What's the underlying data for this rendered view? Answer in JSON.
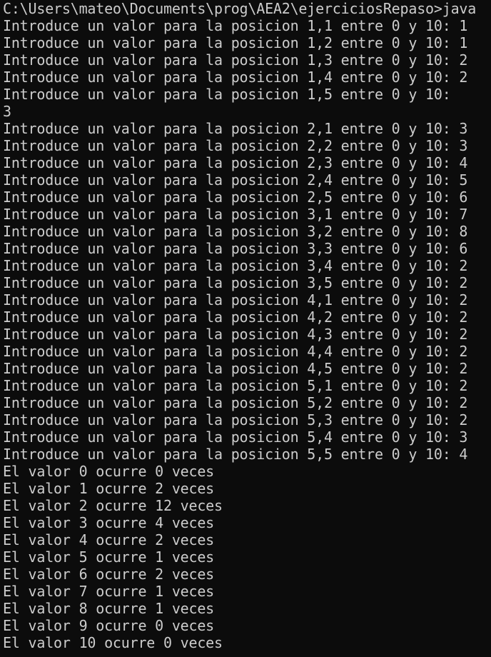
{
  "terminal": {
    "prompt": "C:\\Users\\mateo\\Documents\\prog\\AEA2\\ejerciciosRepaso>java",
    "lines": [
      "Introduce un valor para la posicion 1,1 entre 0 y 10: 1",
      "Introduce un valor para la posicion 1,2 entre 0 y 10: 1",
      "Introduce un valor para la posicion 1,3 entre 0 y 10: 2",
      "Introduce un valor para la posicion 1,4 entre 0 y 10: 2",
      "Introduce un valor para la posicion 1,5 entre 0 y 10:",
      "3",
      "Introduce un valor para la posicion 2,1 entre 0 y 10: 3",
      "Introduce un valor para la posicion 2,2 entre 0 y 10: 3",
      "Introduce un valor para la posicion 2,3 entre 0 y 10: 4",
      "Introduce un valor para la posicion 2,4 entre 0 y 10: 5",
      "Introduce un valor para la posicion 2,5 entre 0 y 10: 6",
      "Introduce un valor para la posicion 3,1 entre 0 y 10: 7",
      "Introduce un valor para la posicion 3,2 entre 0 y 10: 8",
      "Introduce un valor para la posicion 3,3 entre 0 y 10: 6",
      "Introduce un valor para la posicion 3,4 entre 0 y 10: 2",
      "Introduce un valor para la posicion 3,5 entre 0 y 10: 2",
      "Introduce un valor para la posicion 4,1 entre 0 y 10: 2",
      "Introduce un valor para la posicion 4,2 entre 0 y 10: 2",
      "Introduce un valor para la posicion 4,3 entre 0 y 10: 2",
      "Introduce un valor para la posicion 4,4 entre 0 y 10: 2",
      "Introduce un valor para la posicion 4,5 entre 0 y 10: 2",
      "Introduce un valor para la posicion 5,1 entre 0 y 10: 2",
      "Introduce un valor para la posicion 5,2 entre 0 y 10: 2",
      "Introduce un valor para la posicion 5,3 entre 0 y 10: 2",
      "Introduce un valor para la posicion 5,4 entre 0 y 10: 3",
      "Introduce un valor para la posicion 5,5 entre 0 y 10: 4",
      "El valor 0 ocurre 0 veces",
      "El valor 1 ocurre 2 veces",
      "El valor 2 ocurre 12 veces",
      "El valor 3 ocurre 4 veces",
      "El valor 4 ocurre 2 veces",
      "El valor 5 ocurre 1 veces",
      "El valor 6 ocurre 2 veces",
      "El valor 7 ocurre 1 veces",
      "El valor 8 ocurre 1 veces",
      "El valor 9 ocurre 0 veces",
      "El valor 10 ocurre 0 veces"
    ]
  },
  "colors": {
    "background": "#0c0c0c",
    "text": "#cccccc"
  }
}
